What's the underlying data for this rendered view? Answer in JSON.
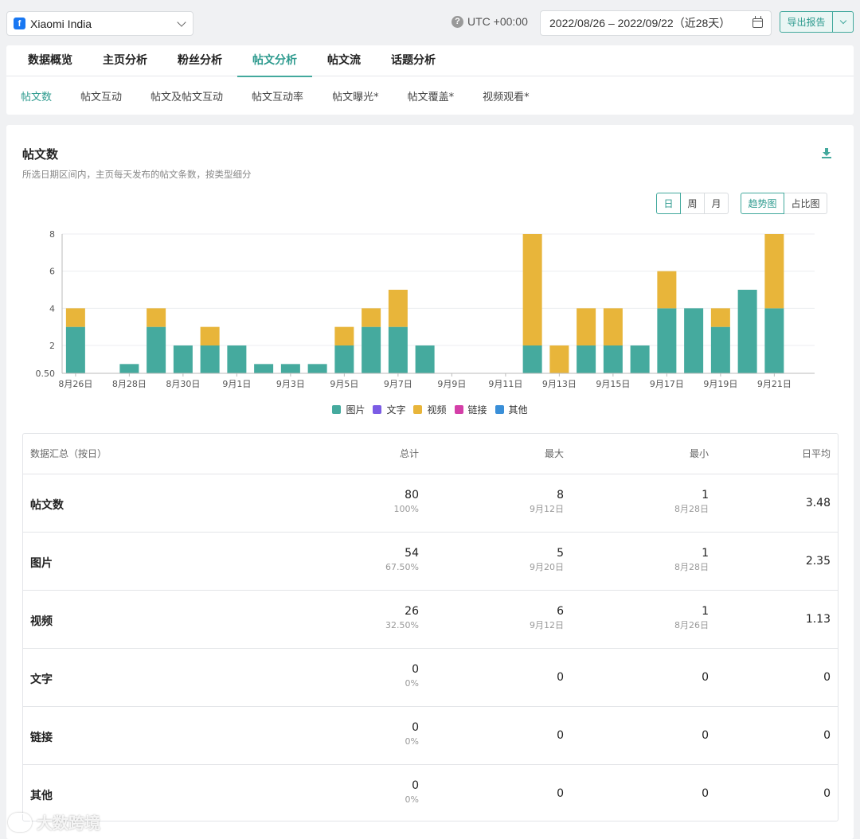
{
  "header": {
    "page_name": "Xiaomi India",
    "timezone": "UTC +00:00",
    "date_range": "2022/08/26 – 2022/09/22（近28天）",
    "export_label": "导出报告"
  },
  "main_tabs": [
    "数据概览",
    "主页分析",
    "粉丝分析",
    "帖文分析",
    "帖文流",
    "话题分析"
  ],
  "active_main_tab": "帖文分析",
  "sub_tabs": [
    "帖文数",
    "帖文互动",
    "帖文及帖文互动",
    "帖文互动率",
    "帖文曝光*",
    "帖文覆盖*",
    "视频观看*"
  ],
  "active_sub_tab": "帖文数",
  "section": {
    "title": "帖文数",
    "description": "所选日期区间内，主页每天发布的帖文条数，按类型细分",
    "period_buttons": [
      "日",
      "周",
      "月"
    ],
    "active_period": "日",
    "view_buttons": [
      "趋势图",
      "占比图"
    ],
    "active_view": "趋势图"
  },
  "chart_data": {
    "type": "bar",
    "stacked": true,
    "categories": [
      "8月26日",
      "8月27日",
      "8月28日",
      "8月29日",
      "8月30日",
      "8月31日",
      "9月1日",
      "9月2日",
      "9月3日",
      "9月4日",
      "9月5日",
      "9月6日",
      "9月7日",
      "9月8日",
      "9月9日",
      "9月10日",
      "9月11日",
      "9月12日",
      "9月13日",
      "9月14日",
      "9月15日",
      "9月16日",
      "9月17日",
      "9月18日",
      "9月19日",
      "9月20日",
      "9月21日",
      "9月22日"
    ],
    "tick_labels": [
      "8月26日",
      "8月28日",
      "8月30日",
      "9月1日",
      "9月3日",
      "9月5日",
      "9月7日",
      "9月9日",
      "9月11日",
      "9月13日",
      "9月15日",
      "9月17日",
      "9月19日",
      "9月21日"
    ],
    "y_tick_labels": [
      "0.50",
      "2",
      "4",
      "6",
      "8"
    ],
    "y_ticks": [
      0.5,
      2,
      4,
      6,
      8
    ],
    "ylim": [
      0.5,
      8
    ],
    "grid": true,
    "legend_position": "bottom",
    "series": [
      {
        "name": "图片",
        "color": "#45aa9e",
        "values": [
          3,
          0,
          1,
          3,
          2,
          2,
          2,
          1,
          1,
          1,
          2,
          3,
          3,
          2,
          0,
          0,
          0,
          2,
          0,
          2,
          2,
          2,
          4,
          4,
          3,
          5,
          4,
          0
        ]
      },
      {
        "name": "文字",
        "color": "#7b5ce5",
        "values": [
          0,
          0,
          0,
          0,
          0,
          0,
          0,
          0,
          0,
          0,
          0,
          0,
          0,
          0,
          0,
          0,
          0,
          0,
          0,
          0,
          0,
          0,
          0,
          0,
          0,
          0,
          0,
          0
        ]
      },
      {
        "name": "视频",
        "color": "#e8b53a",
        "values": [
          1,
          0,
          0,
          1,
          0,
          1,
          0,
          0,
          0,
          0,
          1,
          1,
          2,
          0,
          0,
          0,
          0,
          6,
          2,
          2,
          2,
          0,
          2,
          0,
          1,
          0,
          4,
          0
        ]
      },
      {
        "name": "链接",
        "color": "#d43fa8",
        "values": [
          0,
          0,
          0,
          0,
          0,
          0,
          0,
          0,
          0,
          0,
          0,
          0,
          0,
          0,
          0,
          0,
          0,
          0,
          0,
          0,
          0,
          0,
          0,
          0,
          0,
          0,
          0,
          0
        ]
      },
      {
        "name": "其他",
        "color": "#3a8fd8",
        "values": [
          0,
          0,
          0,
          0,
          0,
          0,
          0,
          0,
          0,
          0,
          0,
          0,
          0,
          0,
          0,
          0,
          0,
          0,
          0,
          0,
          0,
          0,
          0,
          0,
          0,
          0,
          0,
          0
        ]
      }
    ]
  },
  "summary": {
    "headers": [
      "数据汇总（按日）",
      "总计",
      "最大",
      "最小",
      "日平均"
    ],
    "rows": [
      {
        "label": "帖文数",
        "total": "80",
        "total_sub": "100%",
        "max": "8",
        "max_sub": "9月12日",
        "min": "1",
        "min_sub": "8月28日",
        "avg": "3.48"
      },
      {
        "label": "图片",
        "total": "54",
        "total_sub": "67.50%",
        "max": "5",
        "max_sub": "9月20日",
        "min": "1",
        "min_sub": "8月28日",
        "avg": "2.35"
      },
      {
        "label": "视频",
        "total": "26",
        "total_sub": "32.50%",
        "max": "6",
        "max_sub": "9月12日",
        "min": "1",
        "min_sub": "8月26日",
        "avg": "1.13"
      },
      {
        "label": "文字",
        "total": "0",
        "total_sub": "0%",
        "max": "0",
        "max_sub": "",
        "min": "0",
        "min_sub": "",
        "avg": "0"
      },
      {
        "label": "链接",
        "total": "0",
        "total_sub": "0%",
        "max": "0",
        "max_sub": "",
        "min": "0",
        "min_sub": "",
        "avg": "0"
      },
      {
        "label": "其他",
        "total": "0",
        "total_sub": "0%",
        "max": "0",
        "max_sub": "",
        "min": "0",
        "min_sub": "",
        "avg": "0"
      }
    ]
  },
  "watermark": "大数跨境"
}
